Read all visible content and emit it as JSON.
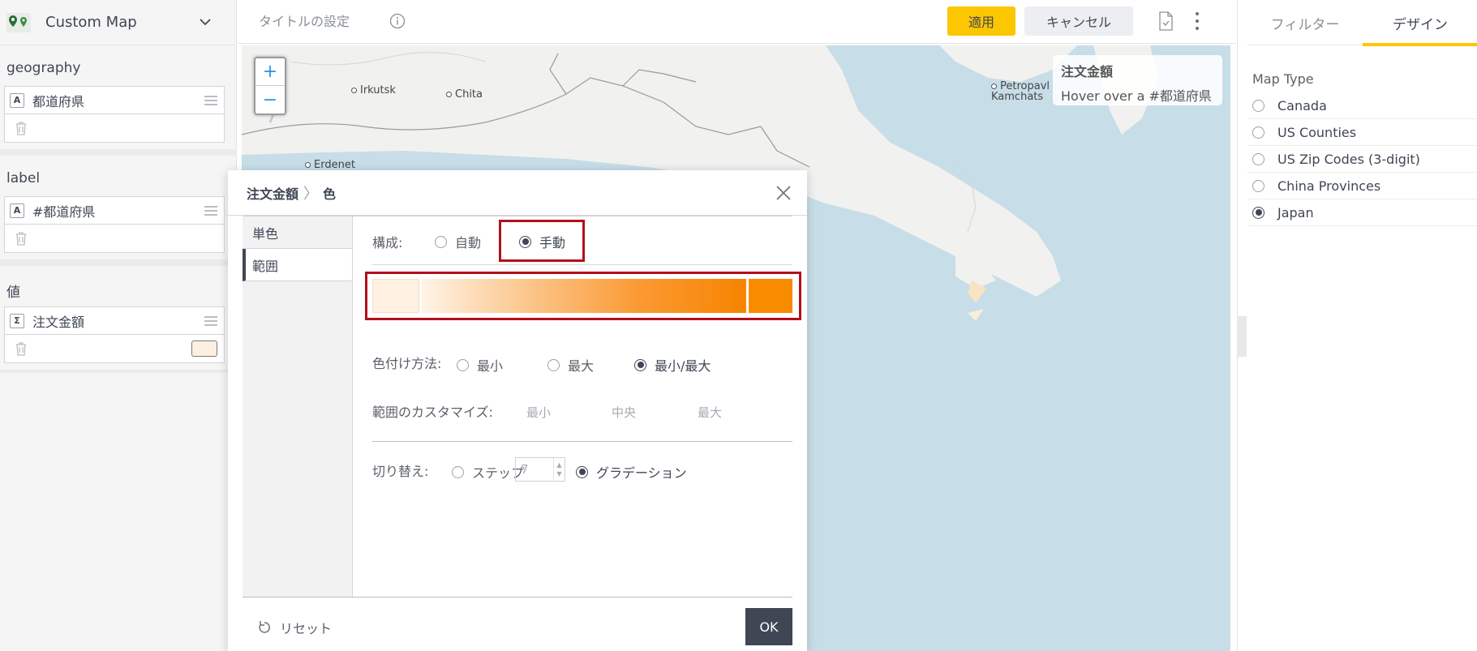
{
  "left_panel": {
    "viz_title": "Custom Map",
    "sections": [
      {
        "label": "geography",
        "field_type": "A",
        "field_name": "都道府県"
      },
      {
        "label": "label",
        "field_type": "A",
        "field_name": "#都道府県"
      },
      {
        "label": "値",
        "field_type": "Σ",
        "field_name": "注文金額",
        "swatch_color": "#fdf0e0"
      }
    ]
  },
  "topbar": {
    "title_setting": "タイトルの設定",
    "apply_label": "適用",
    "cancel_label": "キャンセル"
  },
  "map": {
    "zoom_in": "+",
    "zoom_out": "−",
    "cities": [
      "Irkutsk",
      "Chita",
      "Erdenet",
      "Petropavl\nKamchats"
    ],
    "tooltip": {
      "title": "注文金額",
      "text": "Hover over a #都道府県"
    }
  },
  "right_panel": {
    "tabs": [
      "フィルター",
      "デザイン"
    ],
    "active_tab": 1,
    "map_type_label": "Map Type",
    "map_types": [
      "Canada",
      "US Counties",
      "US Zip Codes (3-digit)",
      "China Provinces",
      "Japan"
    ],
    "selected_map_type": "Japan"
  },
  "dialog": {
    "breadcrumb": [
      "注文金額",
      "色"
    ],
    "sidebar": [
      "単色",
      "範囲"
    ],
    "active_sidebar": "範囲",
    "composition_label": "構成:",
    "composition_options": [
      "自動",
      "手動"
    ],
    "composition_selected": "手動",
    "gradient": {
      "min_color": "#fff0e1",
      "max_color": "#f98b00"
    },
    "coloring_label": "色付け方法:",
    "coloring_options": [
      "最小",
      "最大",
      "最小/最大"
    ],
    "coloring_selected": "最小/最大",
    "range_label": "範囲のカスタマイズ:",
    "range_placeholders": [
      "最小",
      "中央",
      "最大"
    ],
    "switch_label": "切り替え:",
    "switch_options": [
      "ステップ",
      "グラデーション"
    ],
    "switch_selected": "グラデーション",
    "step_value": "7",
    "reset_label": "リセット",
    "ok_label": "OK"
  },
  "colors": {
    "accent": "#fcc600",
    "dark": "#3f4654",
    "highlight": "#b2101a",
    "map_water": "#c7dde8"
  }
}
